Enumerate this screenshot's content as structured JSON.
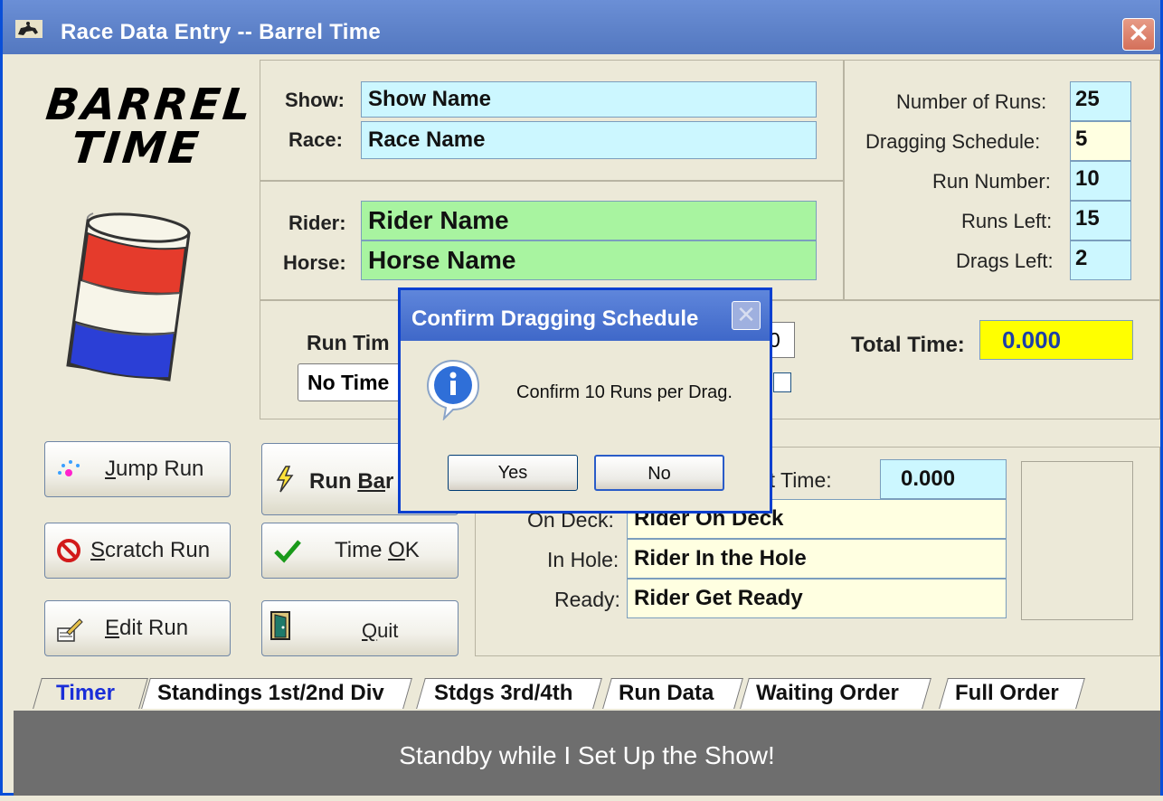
{
  "window": {
    "title": "Race Data Entry -- Barrel Time",
    "close_label": "✕"
  },
  "logo": {
    "line1": "BARREL",
    "line2": "TIME"
  },
  "show_info": {
    "show_label": "Show:",
    "show_value": "Show Name",
    "race_label": "Race:",
    "race_value": "Race Name"
  },
  "rider_info": {
    "rider_label": "Rider:",
    "rider_value": "Rider Name",
    "horse_label": "Horse:",
    "horse_value": "Horse Name"
  },
  "stats": {
    "runs_label": "Number of Runs:",
    "runs_value": "25",
    "drag_label": "Dragging Schedule:",
    "drag_value": "5",
    "run_number_label": "Run Number:",
    "run_number_value": "10",
    "runs_left_label": "Runs Left:",
    "runs_left_value": "15",
    "drags_left_label": "Drags Left:",
    "drags_left_value": "2"
  },
  "timing": {
    "run_time_label": "Run Tim",
    "no_time_label": "No Time",
    "partial_value": "0",
    "total_label": "Total Time:",
    "total_value": "0.000"
  },
  "buttons": {
    "jump_run": {
      "pre": "",
      "u": "J",
      "post": "ump Run"
    },
    "scratch_run": {
      "pre": "",
      "u": "S",
      "post": "cratch Run"
    },
    "edit_run": {
      "pre": "",
      "u": "E",
      "post": "dit Run"
    },
    "run_barrel": {
      "pre": "Run ",
      "u": "Ba",
      "post": "r"
    },
    "time_ok": {
      "pre": "Time ",
      "u": "O",
      "post": "K"
    },
    "quit": {
      "pre": "",
      "u": "Q",
      "post": "uit"
    }
  },
  "queue": {
    "best_label": "Best Time:",
    "best_value": "0.000",
    "deck_label": "On Deck:",
    "deck_value": "Rider On Deck",
    "hole_label": "In Hole:",
    "hole_value": "Rider In the Hole",
    "ready_label": "Ready:",
    "ready_value": "Rider Get Ready"
  },
  "tabs": [
    "Timer",
    "Standings 1st/2nd Div",
    "Stdgs 3rd/4th",
    "Run Data",
    "Waiting Order",
    "Full Order"
  ],
  "status_text": "Standby while I Set Up the Show!",
  "dialog": {
    "title": "Confirm Dragging Schedule",
    "close_label": "✕",
    "message": "Confirm 10 Runs per Drag.",
    "yes_label": "Yes",
    "no_label": "No"
  },
  "colors": {
    "title_bar": "#5e82c9",
    "field_cyan": "#ccf7ff",
    "field_green": "#a8f4a0",
    "field_cream": "#ffffe1",
    "field_yellow": "#ffff00",
    "status_bar": "#6e6e6e"
  }
}
